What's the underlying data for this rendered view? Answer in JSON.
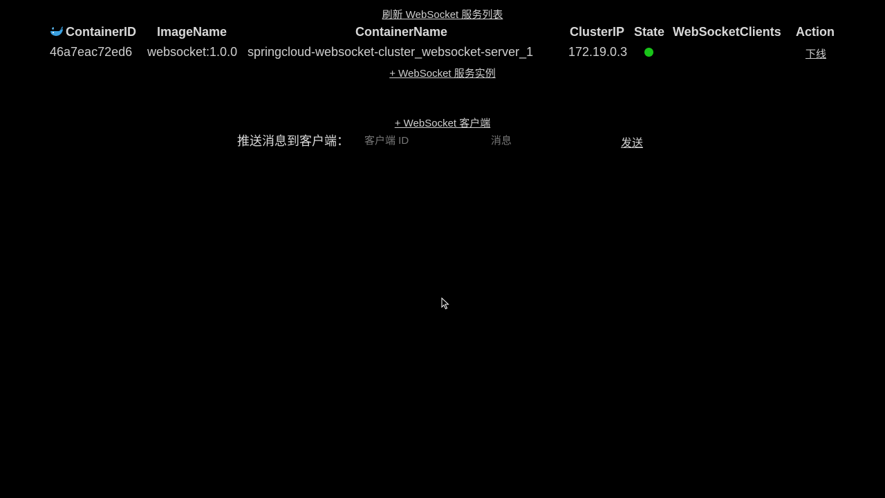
{
  "actions": {
    "refresh_label": "刷新 WebSocket 服务列表",
    "add_service_label": "+ WebSocket 服务实例",
    "add_client_label": "+ WebSocket 客户端"
  },
  "table": {
    "headers": {
      "container_id": "ContainerID",
      "image_name": "ImageName",
      "container_name": "ContainerName",
      "cluster_ip": "ClusterIP",
      "state": "State",
      "websocket_clients": "WebSocketClients",
      "action": "Action"
    },
    "rows": [
      {
        "container_id": "46a7eac72ed6",
        "image_name": "websocket:1.0.0",
        "container_name": "springcloud-websocket-cluster_websocket-server_1",
        "cluster_ip": "172.19.0.3",
        "state_color": "#19c419",
        "websocket_clients": "",
        "action_label": "下线"
      }
    ]
  },
  "push": {
    "label": "推送消息到客户端：",
    "client_id_placeholder": "客户端 ID",
    "message_placeholder": "消息",
    "send_label": "发送"
  },
  "icons": {
    "header_icon": "docker-whale-icon",
    "cursor": "mouse-pointer-icon"
  }
}
